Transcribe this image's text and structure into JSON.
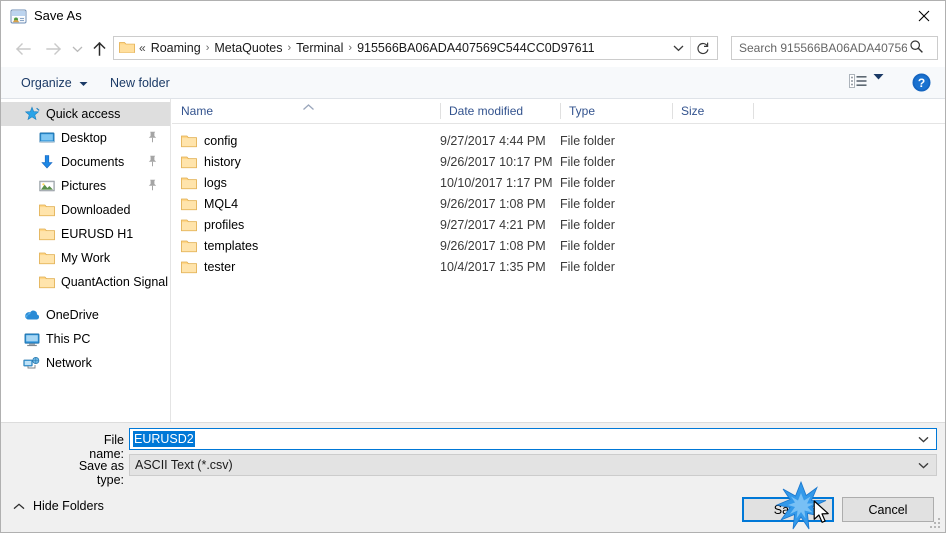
{
  "window": {
    "title": "Save As",
    "icon": "save-as-app-icon",
    "close_label": "×"
  },
  "nav": {
    "back": "back-arrow",
    "forward": "forward-arrow",
    "recent": "recent-locations-chevron",
    "up": "up-arrow",
    "refresh_title": "Refresh"
  },
  "address": {
    "folder_icon": "folder-icon",
    "leading_sep": "«",
    "crumbs": [
      {
        "label": "Roaming"
      },
      {
        "label": "MetaQuotes"
      },
      {
        "label": "Terminal"
      },
      {
        "label": "915566BA06ADA407569C544CC0D97611"
      }
    ],
    "separator": "›",
    "dropdown_icon": "chevron-down-icon",
    "refresh_icon": "refresh-icon"
  },
  "search": {
    "placeholder": "Search 915566BA06ADA40756...",
    "value": "",
    "icon": "search-icon"
  },
  "commandbar": {
    "organize": "Organize",
    "new_folder": "New folder",
    "view_icon": "view-list-icon",
    "view_caret": "chevron-down-icon",
    "help_icon": "help-icon",
    "help_label": "?"
  },
  "sidebar": {
    "groups": [
      {
        "header": {
          "label": "Quick access",
          "icon": "quick-access-star-icon",
          "selected": true
        },
        "items": [
          {
            "label": "Desktop",
            "icon": "desktop-icon",
            "pinned": true
          },
          {
            "label": "Documents",
            "icon": "documents-download-icon",
            "pinned": true
          },
          {
            "label": "Pictures",
            "icon": "pictures-icon",
            "pinned": true
          },
          {
            "label": "Downloaded",
            "icon": "folder-icon",
            "pinned": false
          },
          {
            "label": "EURUSD H1",
            "icon": "folder-icon",
            "pinned": false
          },
          {
            "label": "My Work",
            "icon": "folder-icon",
            "pinned": false
          },
          {
            "label": "QuantAction Signal",
            "icon": "folder-icon",
            "pinned": false
          }
        ]
      },
      {
        "header": {
          "label": "OneDrive",
          "icon": "onedrive-cloud-icon",
          "selected": false
        },
        "items": []
      },
      {
        "header": {
          "label": "This PC",
          "icon": "this-pc-icon",
          "selected": false
        },
        "items": []
      },
      {
        "header": {
          "label": "Network",
          "icon": "network-icon",
          "selected": false
        },
        "items": []
      }
    ]
  },
  "filelist": {
    "columns": [
      {
        "key": "name",
        "label": "Name"
      },
      {
        "key": "date",
        "label": "Date modified"
      },
      {
        "key": "type",
        "label": "Type"
      },
      {
        "key": "size",
        "label": "Size"
      }
    ],
    "sort": {
      "column": "Name",
      "direction": "ascending",
      "icon": "caret-up-icon"
    },
    "rows": [
      {
        "name": "config",
        "date": "9/27/2017 4:44 PM",
        "type": "File folder",
        "size": "",
        "icon": "folder-icon"
      },
      {
        "name": "history",
        "date": "9/26/2017 10:17 PM",
        "type": "File folder",
        "size": "",
        "icon": "folder-icon"
      },
      {
        "name": "logs",
        "date": "10/10/2017 1:17 PM",
        "type": "File folder",
        "size": "",
        "icon": "folder-icon"
      },
      {
        "name": "MQL4",
        "date": "9/26/2017 1:08 PM",
        "type": "File folder",
        "size": "",
        "icon": "folder-icon"
      },
      {
        "name": "profiles",
        "date": "9/27/2017 4:21 PM",
        "type": "File folder",
        "size": "",
        "icon": "folder-icon"
      },
      {
        "name": "templates",
        "date": "9/26/2017 1:08 PM",
        "type": "File folder",
        "size": "",
        "icon": "folder-icon"
      },
      {
        "name": "tester",
        "date": "10/4/2017 1:35 PM",
        "type": "File folder",
        "size": "",
        "icon": "folder-icon"
      }
    ]
  },
  "footer": {
    "filename_label": "File name:",
    "filename_value": "EURUSD2",
    "filename_selected": true,
    "savetype_label": "Save as type:",
    "savetype_value": "ASCII Text (*.csv)",
    "hide_folders_label": "Hide Folders",
    "hide_folders_icon": "caret-up-icon",
    "save_button": "Save",
    "cancel_button": "Cancel",
    "combo_arrow_icon": "chevron-down-icon"
  },
  "overlay": {
    "click_burst": "click-burst-marker",
    "cursor": "mouse-pointer"
  },
  "colors": {
    "accent": "#0078d7",
    "folder": "#ffd687",
    "header_text": "#33538e",
    "chrome_bg": "#f0f0f0",
    "command_bg": "#f7f9fb"
  }
}
